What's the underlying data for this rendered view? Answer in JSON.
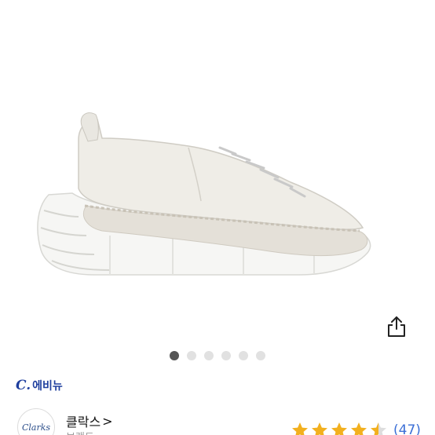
{
  "product": {
    "image_icon": "sneaker-image",
    "share_icon": "share-icon"
  },
  "carousel": {
    "total": 6,
    "active_index": 0
  },
  "retailer": {
    "logo": "C.",
    "name": "에비뉴"
  },
  "brand": {
    "logo_text": "Clarks",
    "name": "클락스",
    "chevron": ">",
    "subtitle": "브랜드"
  },
  "rating": {
    "stars": 4.5,
    "max": 5,
    "count": "(47)"
  },
  "colors": {
    "accent": "#3b6fd6",
    "retailer": "#1f3f9e",
    "star": "#f2b01e",
    "dot_active": "#555555",
    "dot_inactive": "#e1e1e1"
  }
}
